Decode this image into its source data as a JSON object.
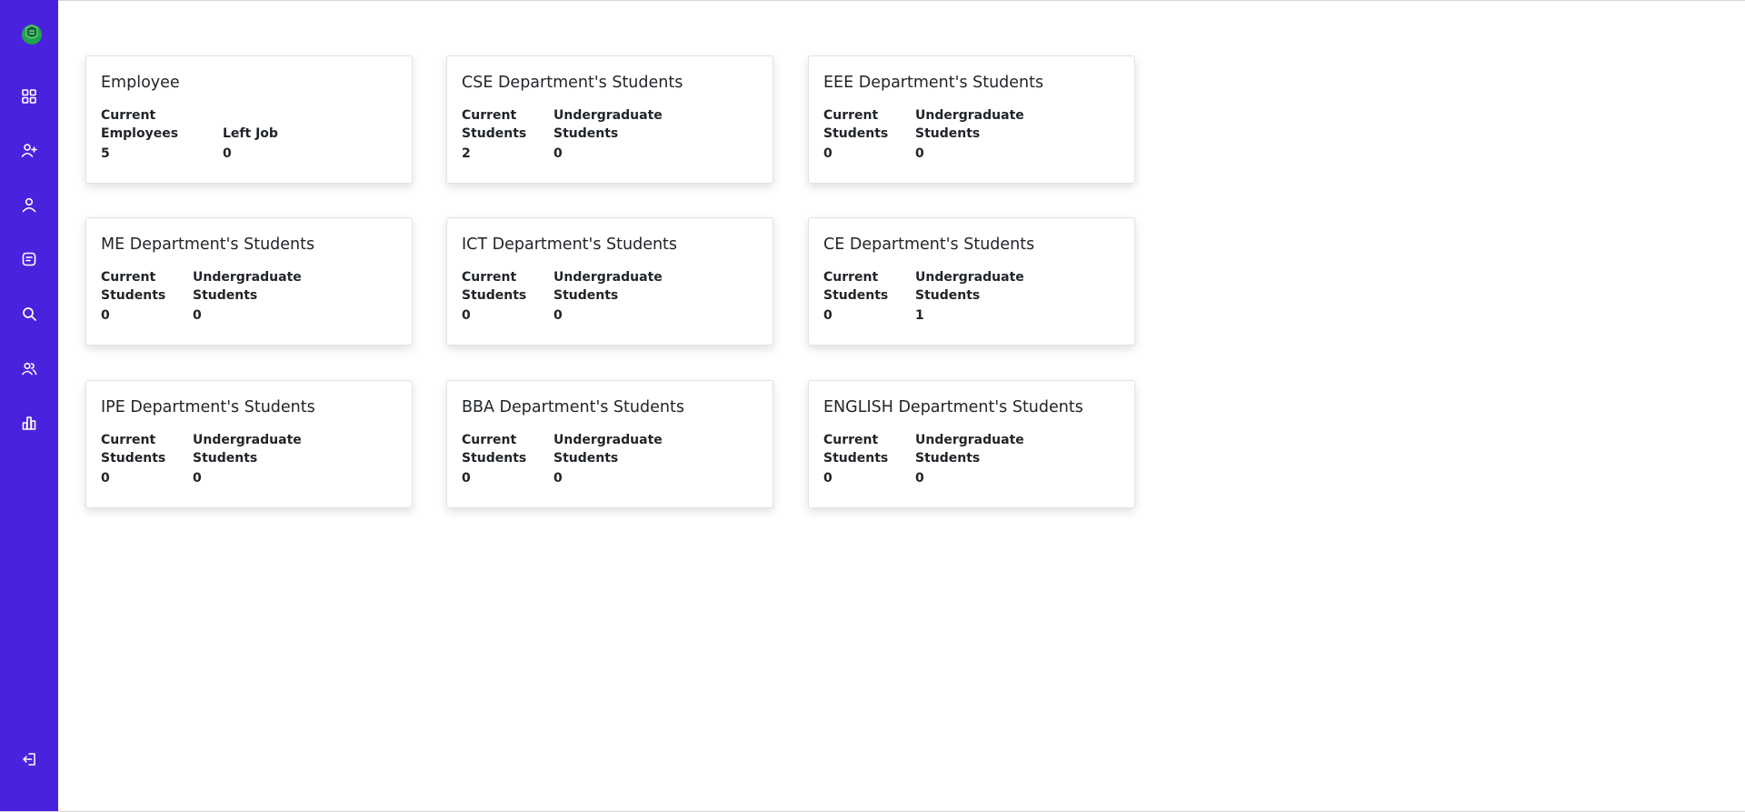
{
  "sidebar": {
    "items": [
      {
        "icon": "dashboard-grid-icon"
      },
      {
        "icon": "add-user-icon"
      },
      {
        "icon": "user-icon"
      },
      {
        "icon": "notes-icon"
      },
      {
        "icon": "search-icon"
      },
      {
        "icon": "users-group-icon"
      },
      {
        "icon": "bar-chart-icon"
      }
    ],
    "logout_icon": "logout-icon",
    "colors": {
      "background": "#4a22de",
      "logo": "#1fa34a"
    }
  },
  "cards": [
    {
      "title": "Employee",
      "stats": [
        {
          "label_line1": "Current",
          "label_line2": "Employees",
          "value": "5"
        },
        {
          "label_line1": "",
          "label_line2": "Left Job",
          "value": "0"
        }
      ]
    },
    {
      "title": "CSE Department's Students",
      "stats": [
        {
          "label_line1": "Current",
          "label_line2": "Students",
          "value": "2"
        },
        {
          "label_line1": "Undergraduate",
          "label_line2": "Students",
          "value": "0"
        }
      ]
    },
    {
      "title": "EEE Department's Students",
      "stats": [
        {
          "label_line1": "Current",
          "label_line2": "Students",
          "value": "0"
        },
        {
          "label_line1": "Undergraduate",
          "label_line2": "Students",
          "value": "0"
        }
      ]
    },
    {
      "title": "ME Department's Students",
      "stats": [
        {
          "label_line1": "Current",
          "label_line2": "Students",
          "value": "0"
        },
        {
          "label_line1": "Undergraduate",
          "label_line2": "Students",
          "value": "0"
        }
      ]
    },
    {
      "title": "ICT Department's Students",
      "stats": [
        {
          "label_line1": "Current",
          "label_line2": "Students",
          "value": "0"
        },
        {
          "label_line1": "Undergraduate",
          "label_line2": "Students",
          "value": "0"
        }
      ]
    },
    {
      "title": "CE Department's Students",
      "stats": [
        {
          "label_line1": "Current",
          "label_line2": "Students",
          "value": "0"
        },
        {
          "label_line1": "Undergraduate",
          "label_line2": "Students",
          "value": "1"
        }
      ]
    },
    {
      "title": "IPE Department's Students",
      "stats": [
        {
          "label_line1": "Current",
          "label_line2": "Students",
          "value": "0"
        },
        {
          "label_line1": "Undergraduate",
          "label_line2": "Students",
          "value": "0"
        }
      ]
    },
    {
      "title": "BBA Department's Students",
      "stats": [
        {
          "label_line1": "Current",
          "label_line2": "Students",
          "value": "0"
        },
        {
          "label_line1": "Undergraduate",
          "label_line2": "Students",
          "value": "0"
        }
      ]
    },
    {
      "title": "ENGLISH Department's Students",
      "stats": [
        {
          "label_line1": "Current",
          "label_line2": "Students",
          "value": "0"
        },
        {
          "label_line1": "Undergraduate",
          "label_line2": "Students",
          "value": "0"
        }
      ]
    }
  ]
}
